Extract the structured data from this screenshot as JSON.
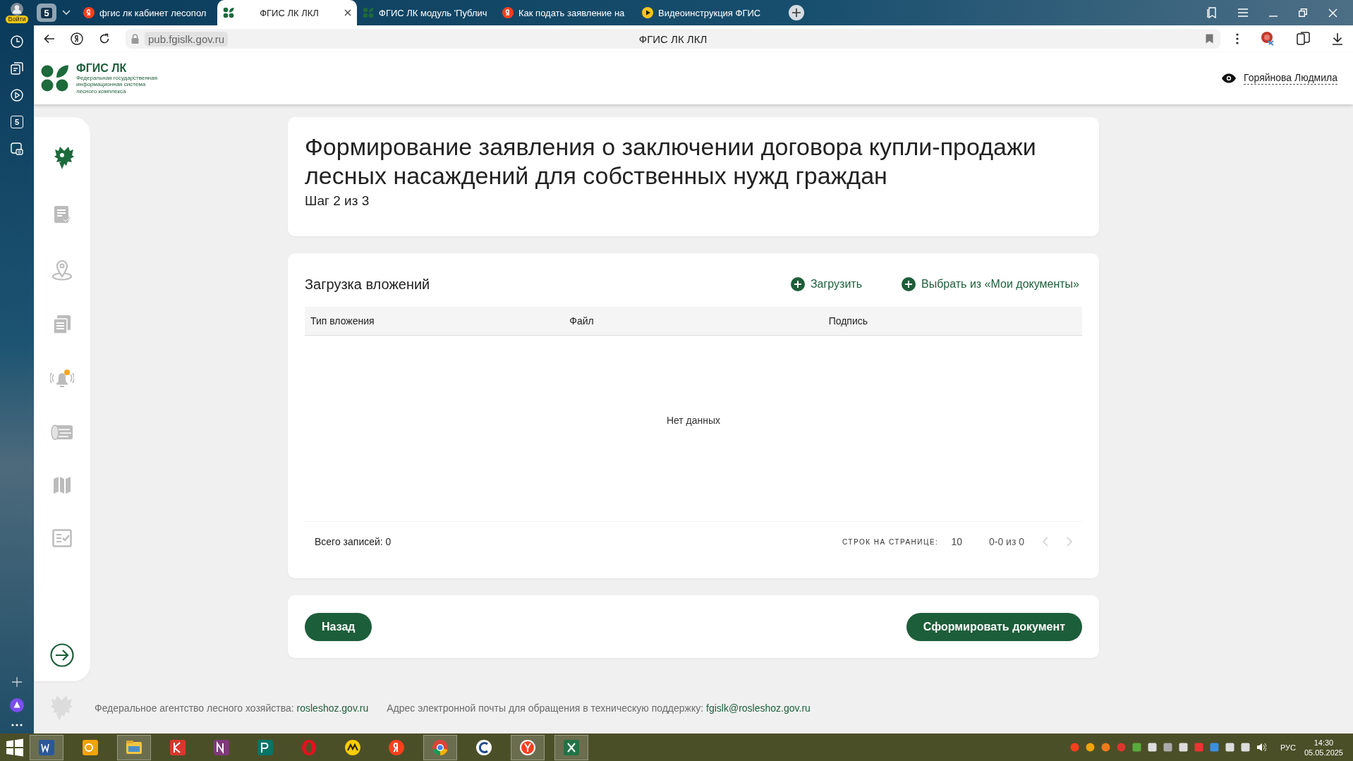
{
  "browser": {
    "profile_label": "Войти",
    "tab_count": "5",
    "tabs": [
      {
        "kind": "yandex",
        "label": "фгис лк кабинет лесопол",
        "selected": false
      },
      {
        "kind": "fgis",
        "label": "ФГИС ЛК ЛКЛ",
        "selected": true
      },
      {
        "kind": "fgis",
        "label": "ФГИС ЛК модуль 'Публич",
        "selected": false
      },
      {
        "kind": "yandex",
        "label": "Как подать заявление на",
        "selected": false
      },
      {
        "kind": "video",
        "label": "Видеоинструкция ФГИС",
        "selected": false
      }
    ],
    "url": "pub.fgislk.gov.ru",
    "page_title": "ФГИС ЛК ЛКЛ",
    "rail_badge": "5"
  },
  "header": {
    "logo_title": "ФГИС ЛК",
    "logo_subtitle": [
      "Федеральная государственная",
      "информационная система",
      "лесного комплекса"
    ],
    "user": "Горяйнова Людмила"
  },
  "form": {
    "title": "Формирование заявления о заключении договора купли-продажи лесных насаждений для собственных нужд граждан",
    "step": "Шаг 2 из 3"
  },
  "attachments": {
    "heading": "Загрузка вложений",
    "actions": [
      "Загрузить",
      "Выбрать из «Мои документы»"
    ],
    "columns": [
      "Тип вложения",
      "Файл",
      "Подпись"
    ],
    "empty_text": "Нет данных",
    "total": "Всего записей: 0",
    "rows_per_page_label": "СТРОК НА СТРАНИЦЕ:",
    "rows_per_page": "10",
    "range": "0-0 из 0",
    "prev_disabled": true,
    "next_disabled": true
  },
  "buttons": {
    "back": "Назад",
    "submit": "Сформировать документ"
  },
  "footer": [
    {
      "label": "Федеральное агентство лесного хозяйства:",
      "link": "rosleshoz.gov.ru"
    },
    {
      "label": "Адрес электронной почты для обращения в техническую поддержку:",
      "link": "fgislk@rosleshoz.gov.ru"
    }
  ],
  "taskbar": {
    "apps": [
      {
        "kind": "word",
        "active": true
      },
      {
        "kind": "outlook",
        "active": false
      },
      {
        "kind": "explorer",
        "active": true
      },
      {
        "kind": "kaspersky",
        "active": false
      },
      {
        "kind": "onenote",
        "active": false
      },
      {
        "kind": "publisher",
        "active": false
      },
      {
        "kind": "opera",
        "active": false
      },
      {
        "kind": "music",
        "active": false
      },
      {
        "kind": "yandex",
        "active": false
      },
      {
        "kind": "chrome",
        "active": true
      },
      {
        "kind": "ccleaner",
        "active": false
      },
      {
        "kind": "ybrowser",
        "active": true
      },
      {
        "kind": "excel",
        "active": true
      }
    ],
    "language": "РУС",
    "time": "14:30",
    "date": "05.05.2025"
  }
}
